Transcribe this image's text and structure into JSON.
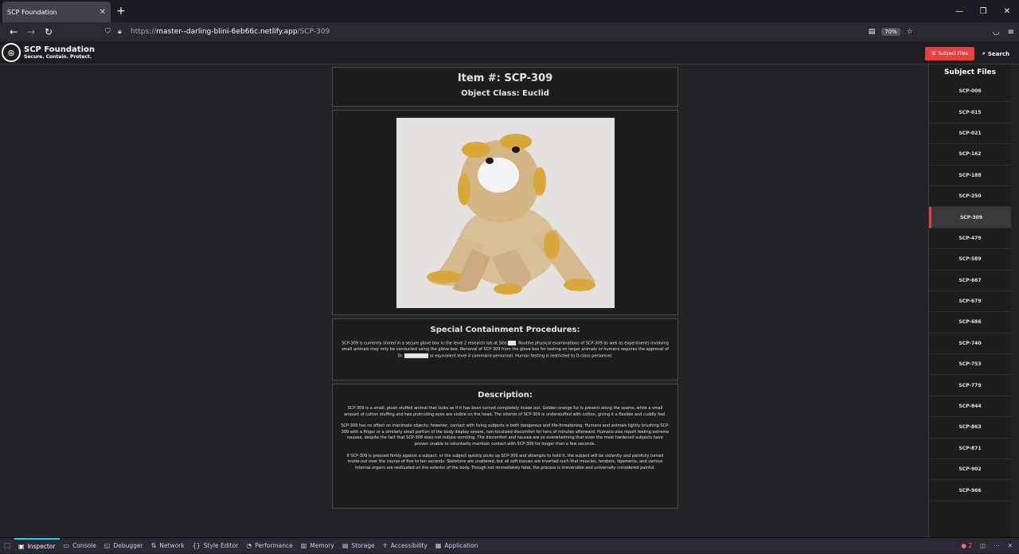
{
  "browser": {
    "tab_title": "SCP Foundation",
    "tab_close": "✕",
    "new_tab": "+",
    "url_protocol": "https://",
    "url_host": "master--darling-blini-6eb66c.netlify.app",
    "url_path": "/SCP-309",
    "zoom": "70%",
    "minimize": "—",
    "restore": "❐",
    "close": "✕"
  },
  "site": {
    "brand_title": "SCP Foundation",
    "brand_tagline": "Secure. Contain. Protect.",
    "subject_files_button": "Subject Files",
    "search_button": "Search"
  },
  "article": {
    "item_title": "Item #: SCP-309",
    "object_class": "Object Class: Euclid",
    "procedures_heading": "Special Containment Procedures:",
    "procedures_text_1": "SCP-309 is currently stored in a secure glove box in the level 2 research lab at Site-",
    "procedures_text_2": ". Routine physical examinations of SCP-309 as well as experiments involving small animals may only be conducted using the glove box. Removal of SCP-309 from the glove box for testing on larger animals or humans requires the approval of Dr. ",
    "procedures_text_3": " or equivalent level 4 command personnel. Human testing is restricted to D-class personnel.",
    "description_heading": "Description:",
    "description_p1": "SCP-309 is a small, plush stuffed animal that looks as if it has been turned completely inside out. Golden-orange fur is present along the seams, while a small amount of cotton stuffing and two protruding eyes are visible on the head. The interior of SCP-309 is understuffed with cotton, giving it a flexible and cuddly feel.",
    "description_p2": "SCP-309 has no effect on inanimate objects; however, contact with living subjects is both dangerous and life-threatening. Humans and animals lightly brushing SCP-309 with a finger or a similarly small portion of the body display severe, non-localized discomfort for tens of minutes afterward. Humans also report feeling extreme nausea, despite the fact that SCP-309 does not induce vomiting. The discomfort and nausea are so overwhelming that even the most hardened subjects have proven unable to voluntarily maintain contact with SCP-309 for longer than a few seconds.",
    "description_p3": "If SCP-309 is pressed firmly against a subject, or the subject quickly picks up SCP-309 and attempts to hold it, the subject will be violently and painfully turned inside-out over the course of five to ten seconds. Skeletons are unaltered, but all soft tissues are inverted such that muscles, tendons, ligaments, and various internal organs are resituated on the exterior of the body. Though not immediately fatal, the process is irreversible and universally considered painful."
  },
  "sidebar": {
    "heading": "Subject Files",
    "items": [
      "SCP-006",
      "SCP-015",
      "SCP-021",
      "SCP-162",
      "SCP-188",
      "SCP-250",
      "SCP-309",
      "SCP-479",
      "SCP-589",
      "SCP-667",
      "SCP-679",
      "SCP-686",
      "SCP-740",
      "SCP-753",
      "SCP-779",
      "SCP-844",
      "SCP-863",
      "SCP-871",
      "SCP-902",
      "SCP-966"
    ],
    "active": "SCP-309"
  },
  "devtools": {
    "tabs": [
      "Inspector",
      "Console",
      "Debugger",
      "Network",
      "Style Editor",
      "Performance",
      "Memory",
      "Storage",
      "Accessibility",
      "Application"
    ],
    "error_count": "2"
  },
  "colors": {
    "accent": "#e84040",
    "panel": "#1d1d1e",
    "page_bg": "#242426"
  }
}
